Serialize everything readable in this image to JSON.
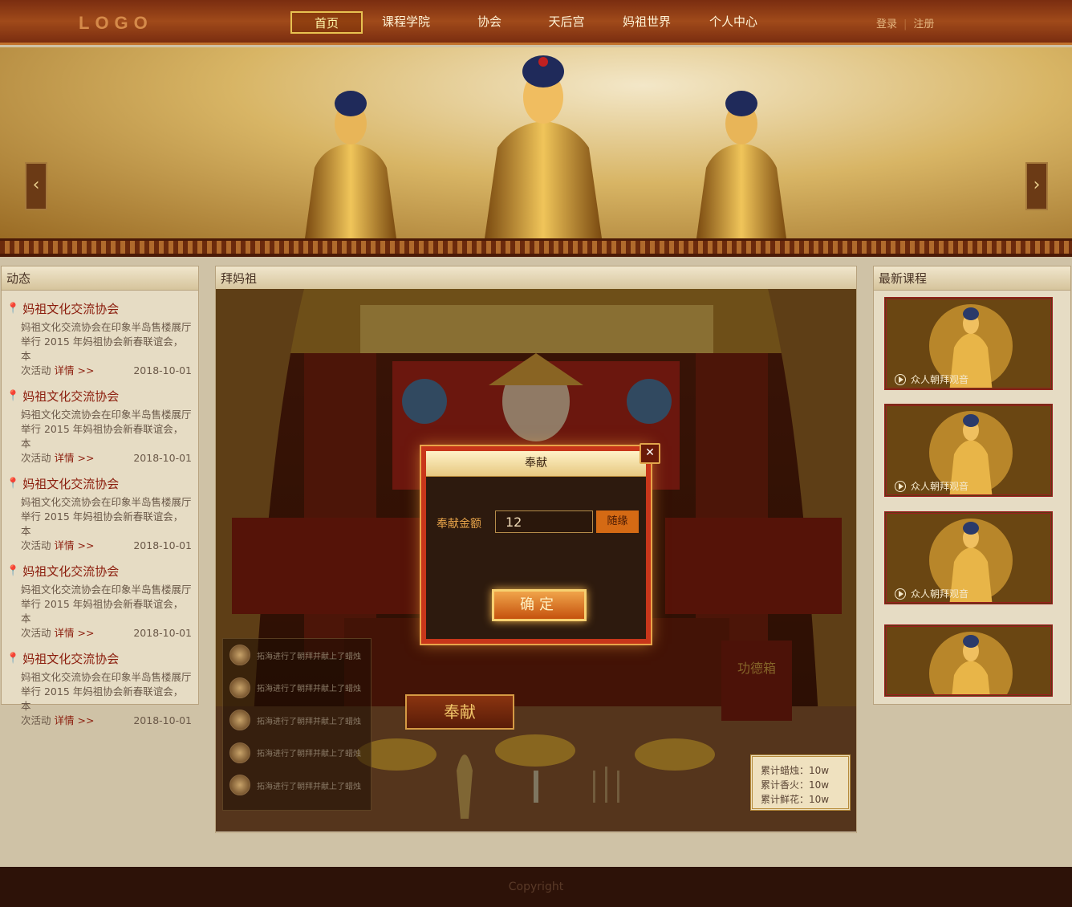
{
  "header": {
    "logo": "LOGO",
    "nav": [
      {
        "label": "首页",
        "active": true
      },
      {
        "label": "课程学院",
        "active": false
      },
      {
        "label": "协会",
        "active": false
      },
      {
        "label": "天后宫",
        "active": false
      },
      {
        "label": "妈祖世界",
        "active": false
      },
      {
        "label": "个人中心",
        "active": false
      }
    ],
    "login": "登录",
    "register": "注册"
  },
  "banner": {
    "slide_count": 2,
    "active_slide": 0
  },
  "news": {
    "title": "动态",
    "items": [
      {
        "title": "妈祖文化交流协会",
        "line1": "妈祖文化交流协会在印象半岛售楼展厅",
        "line2": "举行 2015 年妈祖协会新春联谊会，本",
        "prefix": "次活动",
        "more": "详情 >>",
        "date": "2018-10-01"
      },
      {
        "title": "妈祖文化交流协会",
        "line1": "妈祖文化交流协会在印象半岛售楼展厅",
        "line2": "举行 2015 年妈祖协会新春联谊会，本",
        "prefix": "次活动",
        "more": "详情 >>",
        "date": "2018-10-01"
      },
      {
        "title": "妈祖文化交流协会",
        "line1": "妈祖文化交流协会在印象半岛售楼展厅",
        "line2": "举行 2015 年妈祖协会新春联谊会，本",
        "prefix": "次活动",
        "more": "详情 >>",
        "date": "2018-10-01"
      },
      {
        "title": "妈祖文化交流协会",
        "line1": "妈祖文化交流协会在印象半岛售楼展厅",
        "line2": "举行 2015 年妈祖协会新春联谊会，本",
        "prefix": "次活动",
        "more": "详情 >>",
        "date": "2018-10-01"
      },
      {
        "title": "妈祖文化交流协会",
        "line1": "妈祖文化交流协会在印象半岛售楼展厅",
        "line2": "举行 2015 年妈祖协会新春联谊会，本",
        "prefix": "次活动",
        "more": "详情 >>",
        "date": "2018-10-01"
      }
    ]
  },
  "worship": {
    "title": "拜妈祖",
    "donation_box": "功德箱",
    "offer_button": "奉献",
    "log": [
      "拓海进行了朝拜并献上了蜡烛",
      "拓海进行了朝拜并献上了蜡烛",
      "拓海进行了朝拜并献上了蜡烛",
      "拓海进行了朝拜并献上了蜡烛",
      "拓海进行了朝拜并献上了蜡烛"
    ],
    "stats": [
      "累计蜡烛：10w",
      "累计香火：10w",
      "累计鲜花：10w"
    ]
  },
  "modal": {
    "title": "奉献",
    "amount_label": "奉献金额",
    "amount_value": "12",
    "random_button": "随缘",
    "confirm_button": "确定"
  },
  "courses": {
    "title": "最新课程",
    "items": [
      {
        "caption": "众人朝拜观音"
      },
      {
        "caption": "众人朝拜观音"
      },
      {
        "caption": "众人朝拜观音"
      },
      {
        "caption": ""
      }
    ]
  },
  "footer": {
    "copyright": "Copyright"
  },
  "colors": {
    "accent": "#c8361a",
    "nav_active": "#e7c251",
    "news_title": "#8b1c0c"
  }
}
